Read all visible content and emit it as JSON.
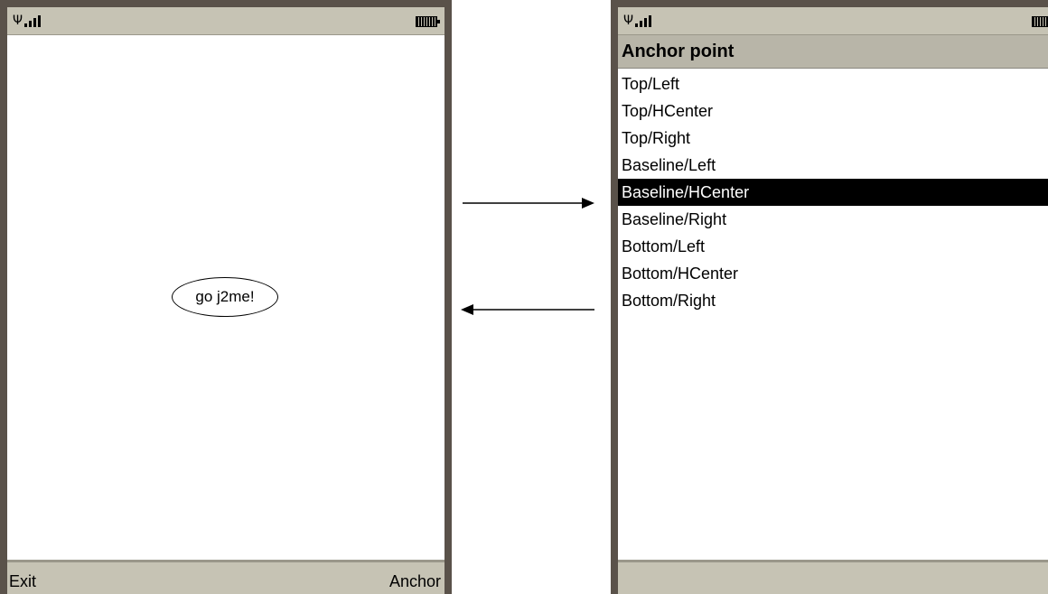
{
  "left_screen": {
    "canvas_text": "go j2me!",
    "softkeys": {
      "left": "Exit",
      "right": "Anchor"
    }
  },
  "right_screen": {
    "title": "Anchor point",
    "items": [
      "Top/Left",
      "Top/HCenter",
      "Top/Right",
      "Baseline/Left",
      "Baseline/HCenter",
      "Baseline/Right",
      "Bottom/Left",
      "Bottom/HCenter",
      "Bottom/Right"
    ],
    "selected_index": 4
  },
  "icons": [
    "antenna-icon",
    "signal-bars-icon",
    "battery-icon",
    "arrow-right-icon",
    "arrow-left-icon"
  ]
}
